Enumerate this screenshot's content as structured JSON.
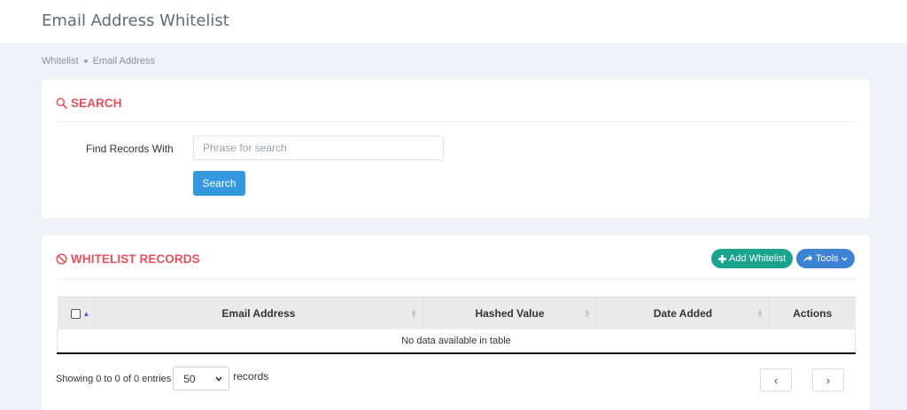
{
  "header": {
    "title": "Email Address Whitelist"
  },
  "breadcrumb": {
    "items": [
      "Whitelist",
      "Email Address"
    ]
  },
  "search_card": {
    "title": "SEARCH",
    "label": "Find Records With",
    "placeholder": "Phrase for search",
    "value": "",
    "button_label": "Search"
  },
  "records_card": {
    "title": "WHITELIST RECORDS",
    "add_button_label": "Add Whitelist",
    "tools_button_label": "Tools",
    "columns": [
      "Email Address",
      "Hashed Value",
      "Date Added",
      "Actions"
    ],
    "empty_message": "No data available in table",
    "info_text": "Showing 0 to 0 of 0 entries",
    "page_size": "50",
    "records_label": "records",
    "prev_label": "‹",
    "next_label": "›"
  },
  "colors": {
    "accent_red": "#e7505a",
    "search_blue": "#3598dc",
    "add_green": "#1aa38d",
    "tools_blue": "#3d82d4"
  },
  "icons": {
    "search_title": "search-icon",
    "records_title": "ban-icon",
    "add": "plus-icon",
    "tools": "share-icon"
  }
}
